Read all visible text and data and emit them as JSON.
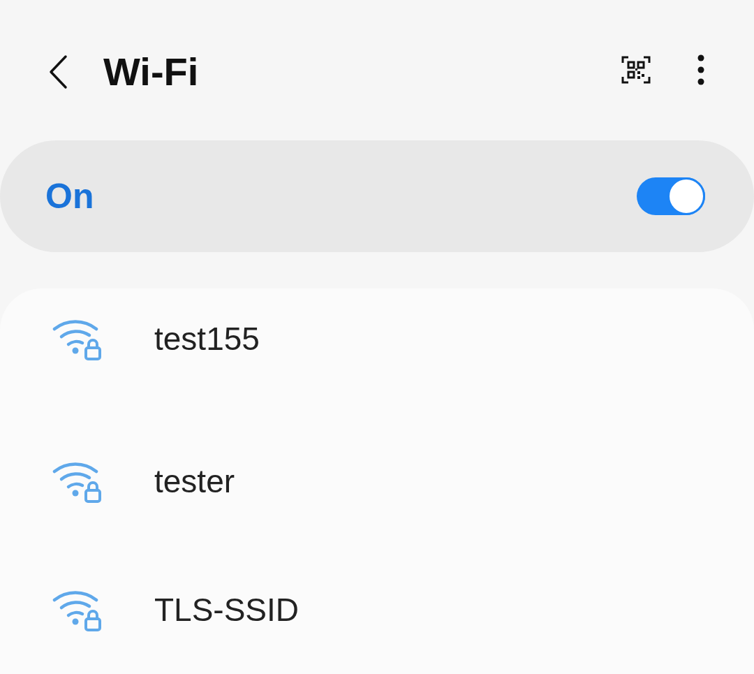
{
  "header": {
    "title": "Wi-Fi"
  },
  "wifi_switch": {
    "label": "On",
    "on": true
  },
  "networks": [
    {
      "name": "test155",
      "secured": true
    },
    {
      "name": "tester",
      "secured": true
    },
    {
      "name": "TLS-SSID",
      "secured": true
    }
  ]
}
